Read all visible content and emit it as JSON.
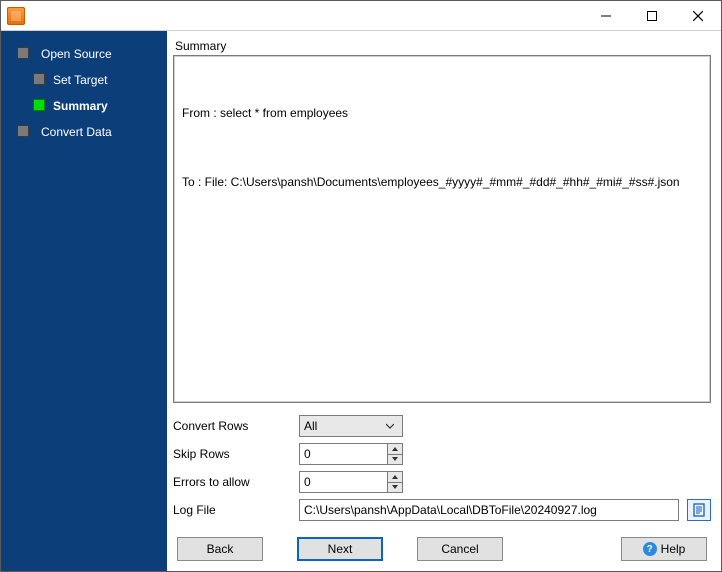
{
  "titlebar": {
    "title": ""
  },
  "sidebar": {
    "items": [
      {
        "label": "Open Source",
        "child": false,
        "active": false
      },
      {
        "label": "Set Target",
        "child": true,
        "active": false
      },
      {
        "label": "Summary",
        "child": true,
        "active": true
      },
      {
        "label": "Convert Data",
        "child": false,
        "active": false
      }
    ]
  },
  "main": {
    "section_label": "Summary",
    "summary": {
      "from_line": "From : select * from employees",
      "to_line": "To : File: C:\\Users\\pansh\\Documents\\employees_#yyyy#_#mm#_#dd#_#hh#_#mi#_#ss#.json"
    },
    "options": {
      "convert_rows_label": "Convert Rows",
      "convert_rows_value": "All",
      "skip_rows_label": "Skip Rows",
      "skip_rows_value": "0",
      "errors_label": "Errors to allow",
      "errors_value": "0",
      "logfile_label": "Log File",
      "logfile_value": "C:\\Users\\pansh\\AppData\\Local\\DBToFile\\20240927.log"
    }
  },
  "buttons": {
    "back": "Back",
    "next": "Next",
    "cancel": "Cancel",
    "help": "Help"
  }
}
